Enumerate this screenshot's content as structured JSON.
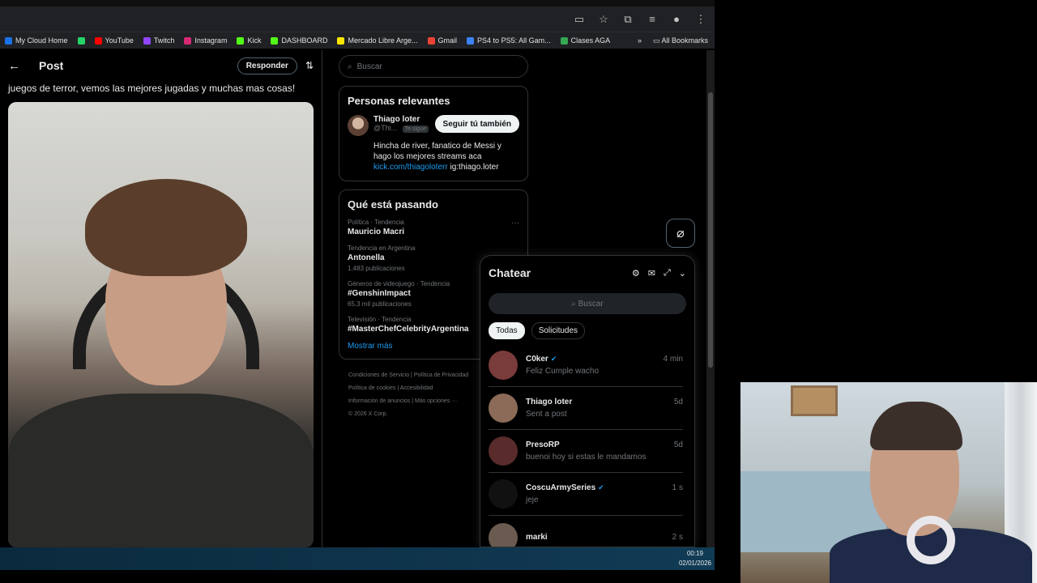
{
  "bookmarks": [
    {
      "label": "My Cloud Home",
      "color": "#1a73e8"
    },
    {
      "label": "",
      "color": "#25d366"
    },
    {
      "label": "YouTube",
      "color": "#ff0000"
    },
    {
      "label": "Twitch",
      "color": "#9146ff"
    },
    {
      "label": "Instagram",
      "color": "#d62976"
    },
    {
      "label": "Kick",
      "color": "#53fc18"
    },
    {
      "label": "DASHBOARD",
      "color": "#53fc18"
    },
    {
      "label": "Mercado Libre Arge...",
      "color": "#ffe600"
    },
    {
      "label": "Gmail",
      "color": "#ea4335"
    },
    {
      "label": "PS4 to PS5: All Gam...",
      "color": "#3b82f6"
    },
    {
      "label": "Clases AGA",
      "color": "#34a853"
    }
  ],
  "all_bookmarks": "All Bookmarks",
  "post": {
    "title": "Post",
    "reply": "Responder",
    "text": "juegos de terror, vemos las mejores jugadas y muchas mas cosas!"
  },
  "sidebar": {
    "search_placeholder": "Buscar",
    "relevant_title": "Personas relevantes",
    "person": {
      "name": "Thiago loter",
      "handle": "@Thi...",
      "follows_you": "Te sigue",
      "follow_button": "Seguir tú también",
      "bio": "Hincha de river, fanatico de Messi y hago los mejores streams aca",
      "link": "kick.com/thiagoloterr",
      "ig": "ig:thiago.loter"
    },
    "trends_title": "Qué está pasando",
    "trends": [
      {
        "meta": "Política · Tendencia",
        "name": "Mauricio Macri",
        "count": ""
      },
      {
        "meta": "Tendencia en Argentina",
        "name": "Antonella",
        "count": "1.483 publicaciones"
      },
      {
        "meta": "Géneros de videojuego · Tendencia",
        "name": "#GenshinImpact",
        "count": "65,3 mil publicaciones"
      },
      {
        "meta": "Televisión · Tendencia",
        "name": "#MasterChefCelebrityArgentina",
        "count": ""
      }
    ],
    "show_more": "Mostrar más",
    "footer": [
      [
        "Condiciones de Servicio",
        "Política de Privacidad"
      ],
      [
        "Política de cookies",
        "Accesibilidad"
      ],
      [
        "Información de anuncios",
        "Más opciones ···"
      ],
      [
        "© 2026 X Corp."
      ]
    ]
  },
  "chat": {
    "title": "Chatear",
    "search_placeholder": "Buscar",
    "tabs": [
      "Todas",
      "Solicitudes"
    ],
    "conversations": [
      {
        "name": "C0ker",
        "verified": true,
        "time": "4 min",
        "message": "Feliz Cumple wacho",
        "color": "#7a3b3b"
      },
      {
        "name": "Thiago loter",
        "verified": false,
        "time": "5d",
        "message": "Sent a post",
        "color": "#8b6b57"
      },
      {
        "name": "PresoRP",
        "verified": false,
        "time": "5d",
        "message": "buenoi hoy si estas le mandamos",
        "color": "#5a2b2b"
      },
      {
        "name": "CoscuArmySeries",
        "verified": true,
        "time": "1 s",
        "message": "jeje",
        "color": "#111111"
      },
      {
        "name": "marki",
        "verified": false,
        "time": "2 s",
        "message": "",
        "color": "#6a5a50"
      }
    ]
  },
  "taskbar": {
    "time": "00:19",
    "date": "02/01/2026"
  }
}
